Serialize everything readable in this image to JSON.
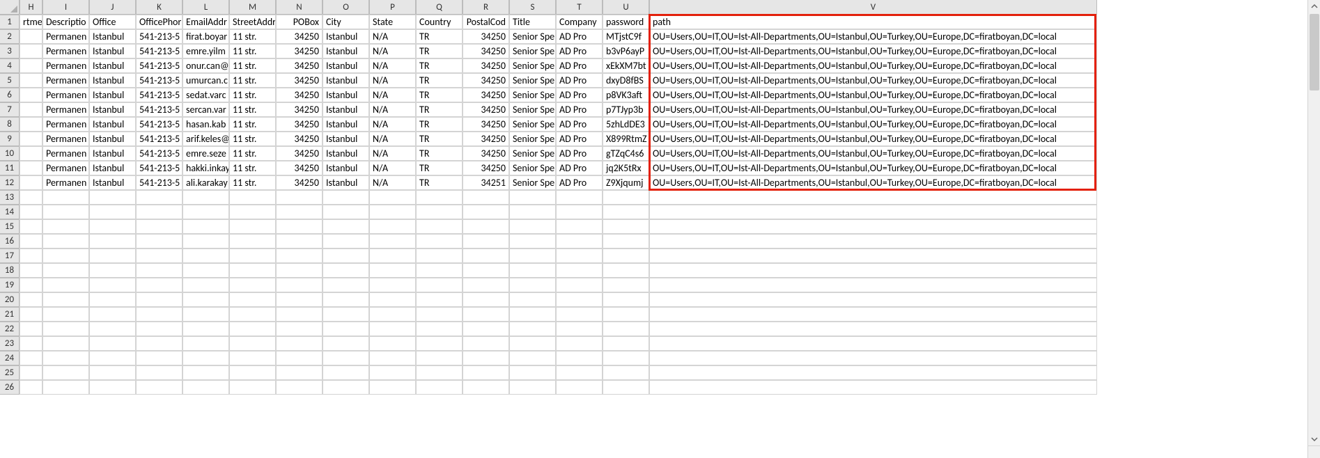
{
  "columns": [
    "H",
    "I",
    "J",
    "K",
    "L",
    "M",
    "N",
    "O",
    "P",
    "Q",
    "R",
    "S",
    "T",
    "U",
    "V"
  ],
  "rowCount": 26,
  "headerRow": {
    "H": "rtmer",
    "I": "Descriptio",
    "J": "Office",
    "K": "OfficePhor",
    "L": "EmailAddr",
    "M": "StreetAddr",
    "N": "POBox",
    "O": "City",
    "P": "State",
    "Q": "Country",
    "R": "PostalCod",
    "S": "Title",
    "T": "Company",
    "U": "password",
    "V": "path"
  },
  "rows": [
    {
      "I": "Permanen",
      "J": "Istanbul",
      "K": "541-213-5",
      "L": "firat.boyar",
      "M": "11 str.",
      "N": "34250",
      "O": "Istanbul",
      "P": "N/A",
      "Q": "TR",
      "R": "34250",
      "S": "Senior Spe",
      "T": "AD Pro",
      "U": "MTjstC9f",
      "V": "OU=Users,OU=IT,OU=Ist-All-Departments,OU=Istanbul,OU=Turkey,OU=Europe,DC=firatboyan,DC=local"
    },
    {
      "I": "Permanen",
      "J": "Istanbul",
      "K": "541-213-5",
      "L": "emre.yilm",
      "M": "11 str.",
      "N": "34250",
      "O": "Istanbul",
      "P": "N/A",
      "Q": "TR",
      "R": "34250",
      "S": "Senior Spe",
      "T": "AD Pro",
      "U": "b3vP6ayP",
      "V": "OU=Users,OU=IT,OU=Ist-All-Departments,OU=Istanbul,OU=Turkey,OU=Europe,DC=firatboyan,DC=local"
    },
    {
      "I": "Permanen",
      "J": "Istanbul",
      "K": "541-213-5",
      "L": "onur.can@",
      "M": "11 str.",
      "N": "34250",
      "O": "Istanbul",
      "P": "N/A",
      "Q": "TR",
      "R": "34250",
      "S": "Senior Spe",
      "T": "AD Pro",
      "U": "xEkXM7bt",
      "V": "OU=Users,OU=IT,OU=Ist-All-Departments,OU=Istanbul,OU=Turkey,OU=Europe,DC=firatboyan,DC=local"
    },
    {
      "I": "Permanen",
      "J": "Istanbul",
      "K": "541-213-5",
      "L": "umurcan.c",
      "M": "11 str.",
      "N": "34250",
      "O": "Istanbul",
      "P": "N/A",
      "Q": "TR",
      "R": "34250",
      "S": "Senior Spe",
      "T": "AD Pro",
      "U": "dxyD8fBS",
      "V": "OU=Users,OU=IT,OU=Ist-All-Departments,OU=Istanbul,OU=Turkey,OU=Europe,DC=firatboyan,DC=local"
    },
    {
      "I": "Permanen",
      "J": "Istanbul",
      "K": "541-213-5",
      "L": "sedat.varc",
      "M": "11 str.",
      "N": "34250",
      "O": "Istanbul",
      "P": "N/A",
      "Q": "TR",
      "R": "34250",
      "S": "Senior Spe",
      "T": "AD Pro",
      "U": "p8VK3aft",
      "V": "OU=Users,OU=IT,OU=Ist-All-Departments,OU=Istanbul,OU=Turkey,OU=Europe,DC=firatboyan,DC=local"
    },
    {
      "I": "Permanen",
      "J": "Istanbul",
      "K": "541-213-5",
      "L": "sercan.var",
      "M": "11 str.",
      "N": "34250",
      "O": "Istanbul",
      "P": "N/A",
      "Q": "TR",
      "R": "34250",
      "S": "Senior Spe",
      "T": "AD Pro",
      "U": "p7TJyp3b",
      "V": "OU=Users,OU=IT,OU=Ist-All-Departments,OU=Istanbul,OU=Turkey,OU=Europe,DC=firatboyan,DC=local"
    },
    {
      "I": "Permanen",
      "J": "Istanbul",
      "K": "541-213-5",
      "L": "hasan.kab",
      "M": "11 str.",
      "N": "34250",
      "O": "Istanbul",
      "P": "N/A",
      "Q": "TR",
      "R": "34250",
      "S": "Senior Spe",
      "T": "AD Pro",
      "U": "5zhLdDE3",
      "V": "OU=Users,OU=IT,OU=Ist-All-Departments,OU=Istanbul,OU=Turkey,OU=Europe,DC=firatboyan,DC=local"
    },
    {
      "I": "Permanen",
      "J": "Istanbul",
      "K": "541-213-5",
      "L": "arif.keles@",
      "M": "11 str.",
      "N": "34250",
      "O": "Istanbul",
      "P": "N/A",
      "Q": "TR",
      "R": "34250",
      "S": "Senior Spe",
      "T": "AD Pro",
      "U": "X899RtmZ",
      "V": "OU=Users,OU=IT,OU=Ist-All-Departments,OU=Istanbul,OU=Turkey,OU=Europe,DC=firatboyan,DC=local"
    },
    {
      "I": "Permanen",
      "J": "Istanbul",
      "K": "541-213-5",
      "L": "emre.seze",
      "M": "11 str.",
      "N": "34250",
      "O": "Istanbul",
      "P": "N/A",
      "Q": "TR",
      "R": "34250",
      "S": "Senior Spe",
      "T": "AD Pro",
      "U": "gTZqC4s6",
      "V": "OU=Users,OU=IT,OU=Ist-All-Departments,OU=Istanbul,OU=Turkey,OU=Europe,DC=firatboyan,DC=local"
    },
    {
      "I": "Permanen",
      "J": "Istanbul",
      "K": "541-213-5",
      "L": "hakki.inkay",
      "M": "11 str.",
      "N": "34250",
      "O": "Istanbul",
      "P": "N/A",
      "Q": "TR",
      "R": "34250",
      "S": "Senior Spe",
      "T": "AD Pro",
      "U": "jq2K5tRx",
      "V": "OU=Users,OU=IT,OU=Ist-All-Departments,OU=Istanbul,OU=Turkey,OU=Europe,DC=firatboyan,DC=local"
    },
    {
      "I": "Permanen",
      "J": "Istanbul",
      "K": "541-213-5",
      "L": "ali.karakay",
      "M": "11 str.",
      "N": "34250",
      "O": "Istanbul",
      "P": "N/A",
      "Q": "TR",
      "R": "34251",
      "S": "Senior Spe",
      "T": "AD Pro",
      "U": "Z9Xjqumj",
      "V": "OU=Users,OU=IT,OU=Ist-All-Departments,OU=Istanbul,OU=Turkey,OU=Europe,DC=firatboyan,DC=local"
    }
  ],
  "numericColumns": [
    "N",
    "R"
  ],
  "highlight": {
    "col": "V",
    "fromRow": 1,
    "toRow": 12
  }
}
